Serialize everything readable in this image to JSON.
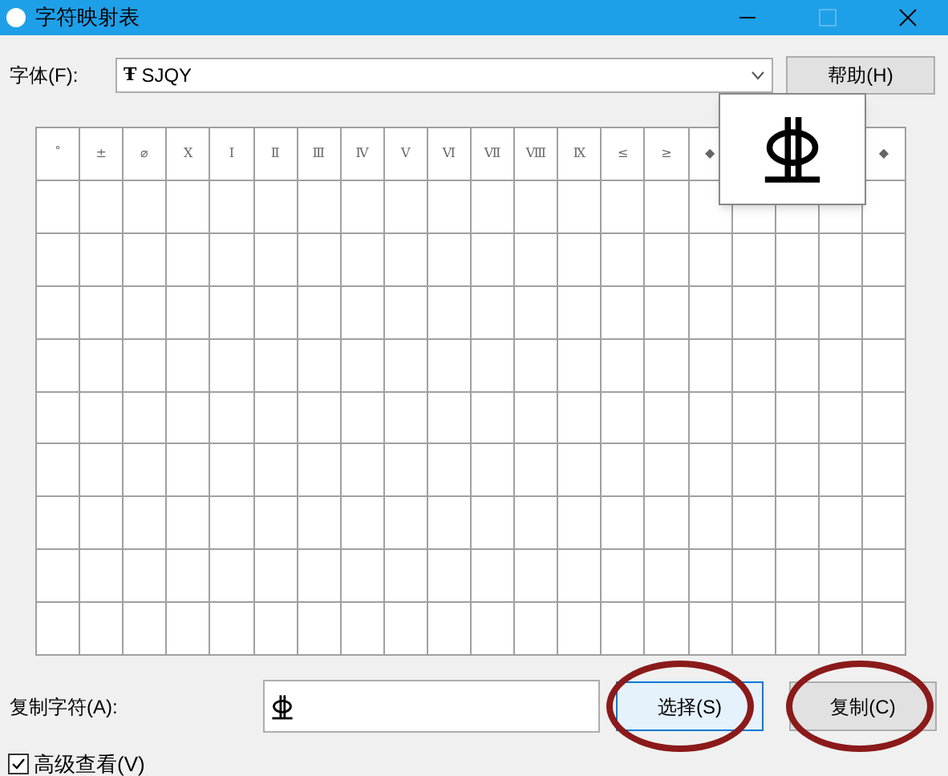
{
  "window": {
    "title": "字符映射表"
  },
  "font": {
    "label": "字体(F):",
    "value": "SJQY",
    "icon": "Ŧ"
  },
  "help_button": "帮助(H)",
  "grid": {
    "first_row": [
      {
        "glyph": "˚"
      },
      {
        "glyph": "±"
      },
      {
        "glyph": "⌀"
      },
      {
        "glyph": "Ⅹ"
      },
      {
        "glyph": "Ⅰ"
      },
      {
        "glyph": "Ⅱ"
      },
      {
        "glyph": "Ⅲ"
      },
      {
        "glyph": "Ⅳ"
      },
      {
        "glyph": "Ⅴ"
      },
      {
        "glyph": "Ⅵ"
      },
      {
        "glyph": "Ⅶ"
      },
      {
        "glyph": "Ⅷ"
      },
      {
        "glyph": "Ⅸ"
      },
      {
        "glyph": "≤"
      },
      {
        "glyph": "≥"
      },
      {
        "glyph": "◆"
      },
      {
        "covered": true
      },
      {
        "covered": true
      },
      {
        "covered": true
      },
      {
        "glyph": "◆"
      }
    ]
  },
  "copy": {
    "label": "复制字符(A):"
  },
  "buttons": [
    {
      "label": "选择(S)",
      "focused": true,
      "circled": true
    },
    {
      "label": "复制(C)",
      "focused": false,
      "circled": true
    }
  ],
  "advanced": {
    "label": "高级查看(V)",
    "checked": true
  }
}
